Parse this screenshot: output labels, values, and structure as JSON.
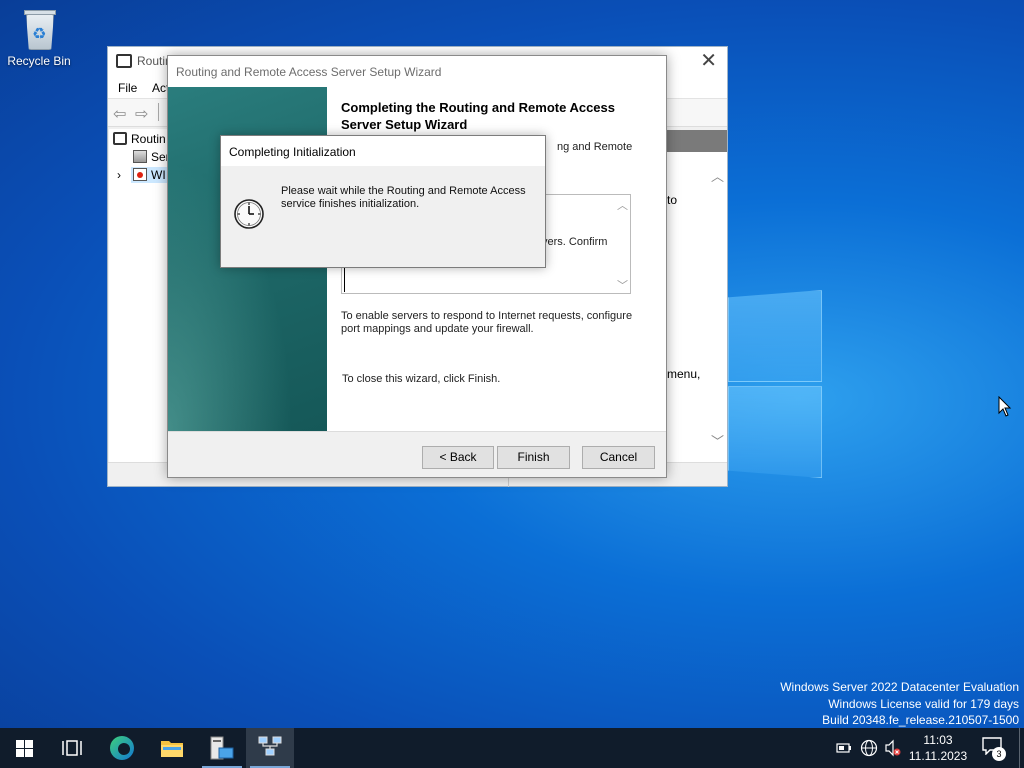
{
  "desktop": {
    "recycle_bin_label": "Recycle Bin",
    "watermark": {
      "line1": "Windows Server 2022 Datacenter Evaluation",
      "line2": "Windows License valid for 179 days",
      "line3": "Build 20348.fe_release.210507-1500"
    }
  },
  "main_window": {
    "title": "Routin",
    "menu": {
      "file": "File",
      "action": "Act"
    },
    "tree": {
      "root": "Routin",
      "server_status": "Ser",
      "server": "WI"
    },
    "right_fragments": {
      "line1": "to",
      "line2": "menu,"
    }
  },
  "wizard": {
    "title": "Routing and Remote Access Server Setup Wizard",
    "heading": "Completing the Routing and Remote Access Server Setup Wizard",
    "intro_fragment": "ng and Remote",
    "summary_fragment_1": "vers. Confirm",
    "summary_fragment_2": ".",
    "paragraph1": "To enable servers to respond to Internet requests, configure port mappings and update your firewall.",
    "paragraph2": "To close this wizard, click Finish.",
    "buttons": {
      "back": "< Back",
      "finish": "Finish",
      "cancel": "Cancel"
    }
  },
  "init_popup": {
    "title": "Completing Initialization",
    "message": "Please wait while the Routing and Remote Access service finishes initialization."
  },
  "taskbar": {
    "time": "11:03",
    "date": "11.11.2023",
    "notification_count": "3"
  },
  "colors": {
    "desktop_accent": "#0b6fd6",
    "taskbar_bg": "#101c2b",
    "wizard_banner": "#1e6868"
  }
}
